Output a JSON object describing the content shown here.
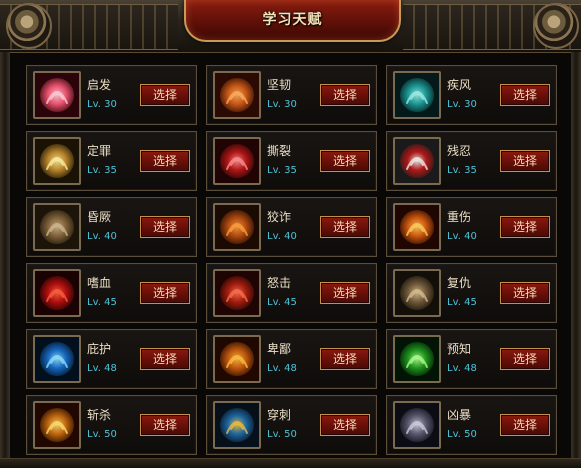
{
  "window": {
    "title": "学习天赋"
  },
  "level_prefix": "Lv.",
  "talents": [
    {
      "name": "启发",
      "level": "30",
      "icon": "pink-orb-icon",
      "colors": [
        "#2a0408",
        "#ff5a7a",
        "#ffd0da"
      ],
      "select_label": "选择"
    },
    {
      "name": "坚韧",
      "level": "30",
      "icon": "heart-icon",
      "colors": [
        "#2a0a02",
        "#d8601a",
        "#ffb060"
      ],
      "select_label": "选择"
    },
    {
      "name": "疾风",
      "level": "30",
      "icon": "wind-icon",
      "colors": [
        "#041a1a",
        "#1ea4a0",
        "#9ff0e8"
      ],
      "select_label": "选择"
    },
    {
      "name": "定罪",
      "level": "35",
      "icon": "bow-icon",
      "colors": [
        "#1a1204",
        "#c89030",
        "#fff0a0"
      ],
      "select_label": "选择"
    },
    {
      "name": "撕裂",
      "level": "35",
      "icon": "claw-slash-icon",
      "colors": [
        "#200404",
        "#c01818",
        "#ff9090"
      ],
      "select_label": "选择"
    },
    {
      "name": "残忍",
      "level": "35",
      "icon": "target-arrow-icon",
      "colors": [
        "#1a1a1a",
        "#c01818",
        "#f0f0f0"
      ],
      "select_label": "选择"
    },
    {
      "name": "昏厥",
      "level": "40",
      "icon": "figures-icon",
      "colors": [
        "#1c1408",
        "#8a6a40",
        "#d0b890"
      ],
      "select_label": "选择"
    },
    {
      "name": "狡诈",
      "level": "40",
      "icon": "chain-icon",
      "colors": [
        "#1a0a02",
        "#c05010",
        "#ffa040"
      ],
      "select_label": "选择"
    },
    {
      "name": "重伤",
      "level": "40",
      "icon": "burning-warrior-icon",
      "colors": [
        "#200600",
        "#e06010",
        "#ffd060"
      ],
      "select_label": "选择"
    },
    {
      "name": "嗜血",
      "level": "45",
      "icon": "demon-face-icon",
      "colors": [
        "#1a0202",
        "#c01010",
        "#ff6040"
      ],
      "select_label": "选择"
    },
    {
      "name": "怒击",
      "level": "45",
      "icon": "flexed-arm-icon",
      "colors": [
        "#1e0402",
        "#b02010",
        "#ff7050"
      ],
      "select_label": "选择"
    },
    {
      "name": "复仇",
      "level": "45",
      "icon": "screaming-face-icon",
      "colors": [
        "#120e08",
        "#7a6040",
        "#d8c090"
      ],
      "select_label": "选择"
    },
    {
      "name": "庇护",
      "level": "48",
      "icon": "meditating-figure-icon",
      "colors": [
        "#02101e",
        "#1870d0",
        "#90e0ff"
      ],
      "select_label": "选择"
    },
    {
      "name": "卑鄙",
      "level": "48",
      "icon": "fire-swirl-icon",
      "colors": [
        "#200800",
        "#d06010",
        "#ffc040"
      ],
      "select_label": "选择"
    },
    {
      "name": "预知",
      "level": "48",
      "icon": "green-figure-icon",
      "colors": [
        "#021404",
        "#20a020",
        "#b0ff90"
      ],
      "select_label": "选择"
    },
    {
      "name": "斩杀",
      "level": "50",
      "icon": "blade-slash-icon",
      "colors": [
        "#200800",
        "#d07010",
        "#ffe070"
      ],
      "select_label": "选择"
    },
    {
      "name": "穿刺",
      "level": "50",
      "icon": "shield-emblem-icon",
      "colors": [
        "#06101a",
        "#2070b0",
        "#f0c040"
      ],
      "select_label": "选择"
    },
    {
      "name": "凶暴",
      "level": "50",
      "icon": "hooded-figure-icon",
      "colors": [
        "#0c0c14",
        "#606078",
        "#d0d0e0"
      ],
      "select_label": "选择"
    }
  ]
}
